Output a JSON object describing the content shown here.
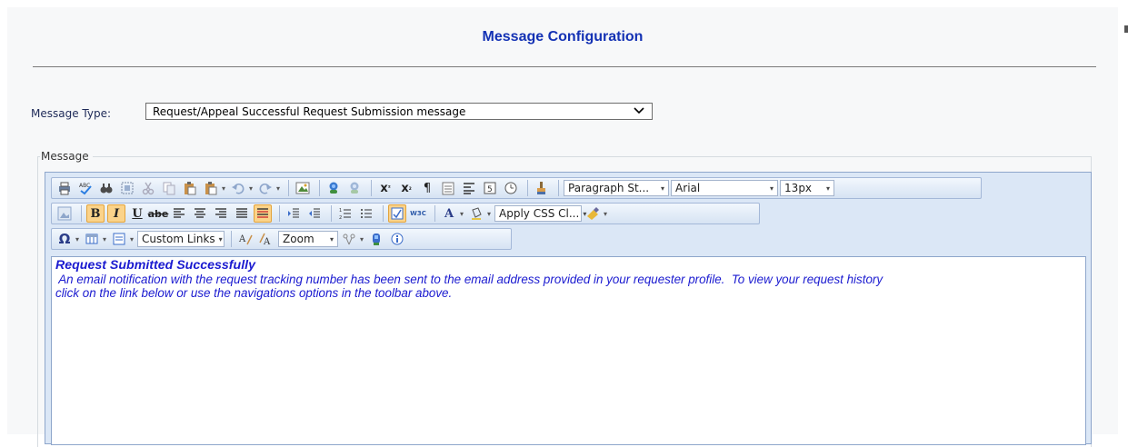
{
  "page": {
    "title": "Message Configuration"
  },
  "message_type": {
    "label": "Message Type:",
    "selected": "Request/Appeal Successful Request Submission message"
  },
  "message_group": {
    "legend": "Message"
  },
  "toolbar": {
    "row1": {
      "paragraph_style": "Paragraph St...",
      "font_name": "Arial",
      "font_size": "13px"
    },
    "row2": {
      "bold": "B",
      "italic": "I",
      "underline": "U",
      "strike": "abe",
      "w3c": "W3C",
      "apply_css": "Apply CSS Cl..."
    },
    "row3": {
      "custom_links": "Custom Links",
      "zoom": "Zoom"
    }
  },
  "content": {
    "heading": "Request  Submitted Successfully",
    "line1": " An email notification with the request tracking number has been sent to the email address provided in your requester profile.  To view your request history",
    "line2": "click on the link below or use the navigations options in the toolbar above."
  },
  "icons": [
    "print-icon",
    "spellcheck-icon",
    "find-icon",
    "select-all-icon",
    "cut-icon",
    "copy-icon",
    "paste-icon",
    "paste-options-icon",
    "undo-icon",
    "redo-icon",
    "image-icon",
    "link-icon",
    "unlink-icon",
    "superscript-icon",
    "subscript-icon",
    "paragraph-icon",
    "insert-date-icon",
    "align-icon",
    "form-icon",
    "time-icon",
    "format-painter-icon",
    "image-manager-icon",
    "indent-icon",
    "outdent-icon",
    "ordered-list-icon",
    "unordered-list-icon",
    "html-mode-icon",
    "font-color-icon",
    "highlight-color-icon",
    "css-eraser-icon",
    "special-char-icon",
    "table-icon",
    "layout-icon",
    "font-grow-icon",
    "font-shrink-icon",
    "snippets-icon",
    "module-icon",
    "about-icon"
  ]
}
